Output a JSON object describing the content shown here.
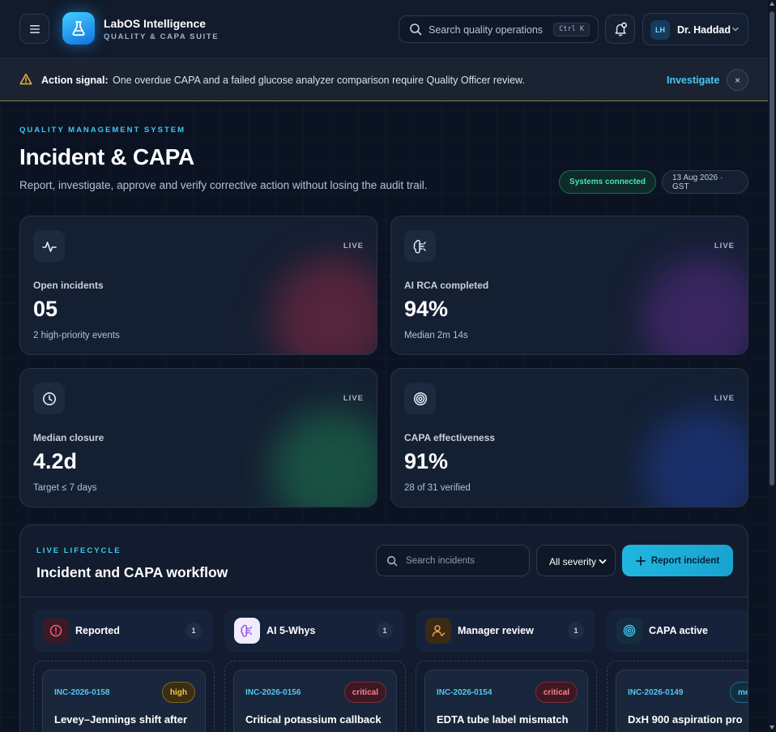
{
  "app": {
    "brand_title": "LabOS Intelligence",
    "brand_subtitle": "QUALITY & CAPA SUITE",
    "search_placeholder": "Search quality operations",
    "search_shortcut": "Ctrl K",
    "user_initials": "LH",
    "user_name": "Dr. Haddad"
  },
  "alert": {
    "label": "Action signal:",
    "message": "One overdue CAPA and a failed glucose analyzer comparison require Quality Officer review.",
    "link": "Investigate",
    "close": "×"
  },
  "header": {
    "eyebrow": "QUALITY MANAGEMENT SYSTEM",
    "title": "Incident & CAPA",
    "subtitle": "Report, investigate, approve and verify corrective action without losing the audit trail.",
    "status": "Systems connected",
    "date": "13 Aug 2026 · GST"
  },
  "kpis": [
    {
      "label": "Open incidents",
      "value": "05",
      "footnote": "2 high-priority events",
      "tag": "LIVE",
      "icon": "pulse-icon",
      "glow": "#8a2a45"
    },
    {
      "label": "AI RCA completed",
      "value": "94%",
      "footnote": "Median 2m 14s",
      "tag": "LIVE",
      "icon": "brain-icon",
      "glow": "#5a2d8a"
    },
    {
      "label": "Median closure",
      "value": "4.2d",
      "footnote": "Target ≤ 7 days",
      "tag": "LIVE",
      "icon": "clock-icon",
      "glow": "#1e7a50"
    },
    {
      "label": "CAPA effectiveness",
      "value": "91%",
      "footnote": "28 of 31 verified",
      "tag": "LIVE",
      "icon": "target-icon",
      "glow": "#1f3f9a"
    }
  ],
  "workflow": {
    "eyebrow": "LIVE LIFECYCLE",
    "title": "Incident and CAPA workflow",
    "search_placeholder": "Search incidents",
    "severity_selected": "All severity",
    "report_button": "Report incident",
    "stages": [
      {
        "name": "Reported",
        "count": "1",
        "icon": "alert-circle-icon"
      },
      {
        "name": "AI 5-Whys",
        "count": "1",
        "icon": "brain-icon"
      },
      {
        "name": "Manager review",
        "count": "1",
        "icon": "user-icon"
      },
      {
        "name": "CAPA active",
        "count": "",
        "icon": "target-icon"
      }
    ],
    "cards": [
      {
        "id": "INC-2026-0158",
        "severity": "high",
        "title": "Levey–Jennings shift after"
      },
      {
        "id": "INC-2026-0156",
        "severity": "critical",
        "title": "Critical potassium callback"
      },
      {
        "id": "INC-2026-0154",
        "severity": "critical",
        "title": "EDTA tube label mismatch"
      },
      {
        "id": "INC-2026-0149",
        "severity": "medium",
        "title": "DxH 900 aspiration pro"
      }
    ]
  },
  "colors": {
    "accent": "#3fc8f2",
    "background": "#0b1322",
    "card": "#141f32"
  }
}
